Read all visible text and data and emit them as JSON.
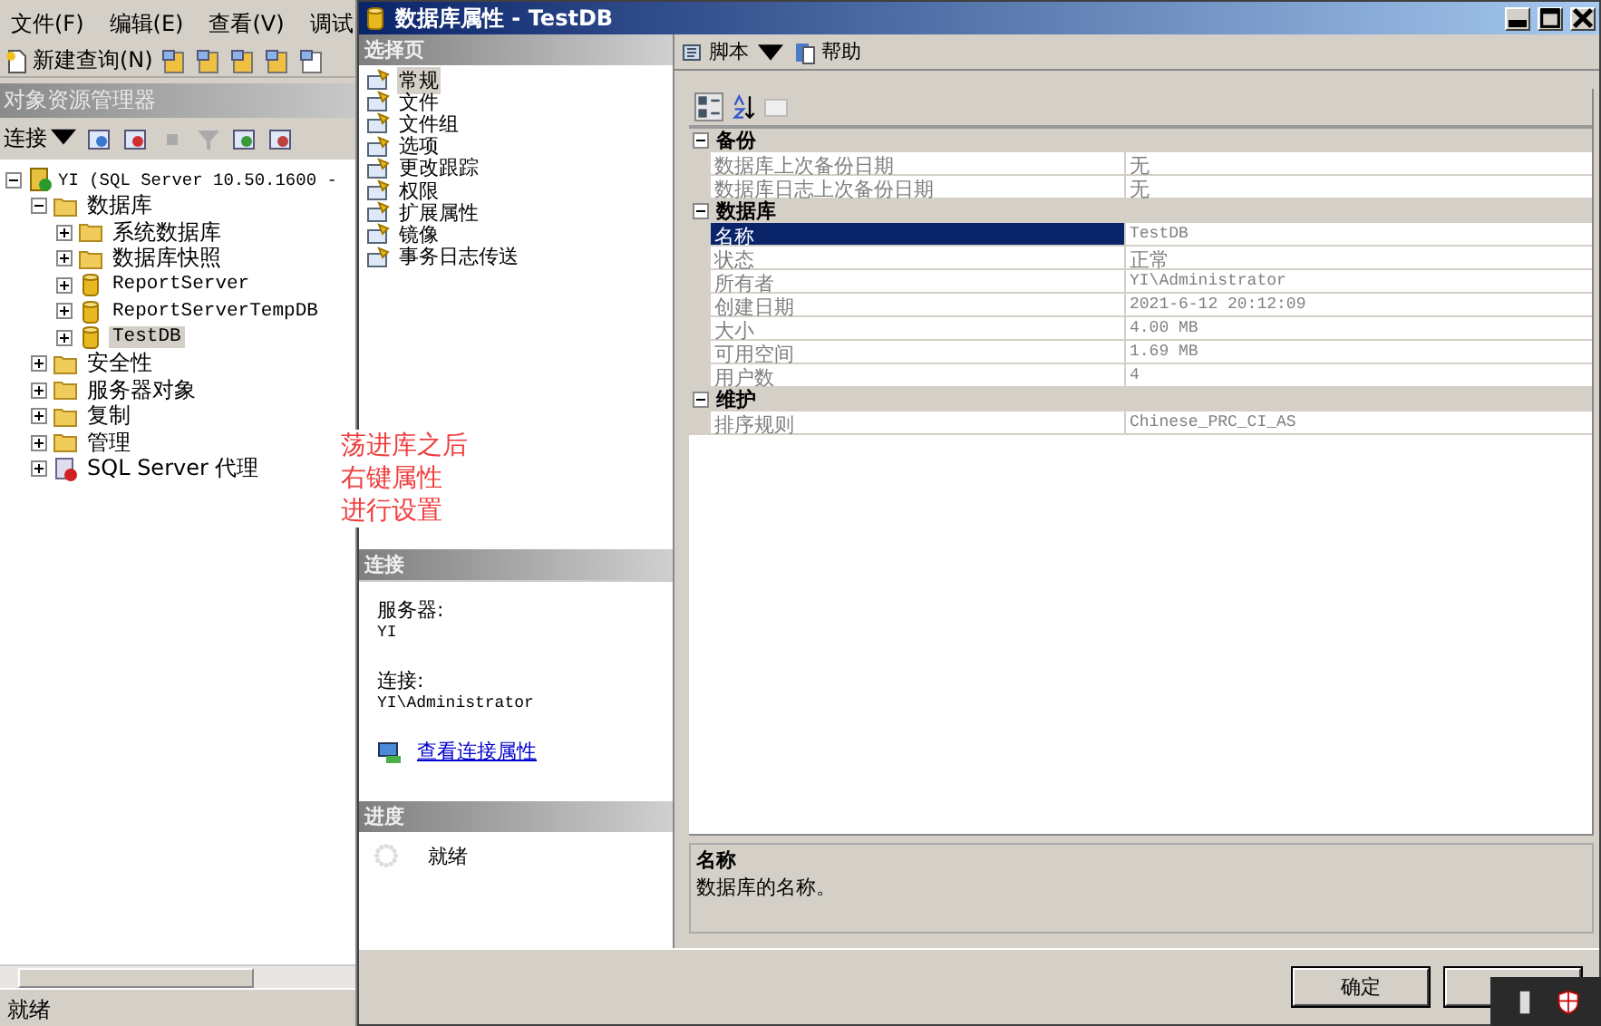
{
  "explorer": {
    "menu": [
      {
        "label": "文件(F)"
      },
      {
        "label": "编辑(E)"
      },
      {
        "label": "查看(V)"
      },
      {
        "label": "调试"
      }
    ],
    "new_query": "新建查询(N)",
    "title": "对象资源管理器",
    "connect": "连接",
    "tree": [
      {
        "label": "YI (SQL Server 10.50.1600 -",
        "kind": "server",
        "expanded": true,
        "selected": false,
        "children": [
          {
            "label": "数据库",
            "kind": "folder",
            "expanded": true,
            "selected": false,
            "children": [
              {
                "label": "系统数据库",
                "kind": "folder",
                "expanded": false,
                "selected": false
              },
              {
                "label": "数据库快照",
                "kind": "folder",
                "expanded": false,
                "selected": false
              },
              {
                "label": "ReportServer",
                "kind": "database",
                "expanded": false,
                "selected": false
              },
              {
                "label": "ReportServerTempDB",
                "kind": "database",
                "expanded": false,
                "selected": false
              },
              {
                "label": "TestDB",
                "kind": "database",
                "expanded": false,
                "selected": true
              }
            ]
          },
          {
            "label": "安全性",
            "kind": "folder",
            "expanded": false,
            "selected": false
          },
          {
            "label": "服务器对象",
            "kind": "folder",
            "expanded": false,
            "selected": false
          },
          {
            "label": "复制",
            "kind": "folder",
            "expanded": false,
            "selected": false
          },
          {
            "label": "管理",
            "kind": "folder",
            "expanded": false,
            "selected": false
          },
          {
            "label": "SQL Server 代理",
            "kind": "agent",
            "expanded": false,
            "selected": false
          }
        ]
      }
    ],
    "status": "就绪"
  },
  "note": [
    "荡进库之后",
    "右键属性",
    "进行设置"
  ],
  "dialog": {
    "title": "数据库属性 - TestDB",
    "select_page": {
      "title": "选择页",
      "items": [
        {
          "label": "常规",
          "selected": true
        },
        {
          "label": "文件",
          "selected": false
        },
        {
          "label": "文件组",
          "selected": false
        },
        {
          "label": "选项",
          "selected": false
        },
        {
          "label": "更改跟踪",
          "selected": false
        },
        {
          "label": "权限",
          "selected": false
        },
        {
          "label": "扩展属性",
          "selected": false
        },
        {
          "label": "镜像",
          "selected": false
        },
        {
          "label": "事务日志传送",
          "selected": false
        }
      ]
    },
    "connection": {
      "title": "连接",
      "server_label": "服务器:",
      "server": "YI",
      "connection_label": "连接:",
      "connection": "YI\\Administrator",
      "link": "查看连接属性"
    },
    "progress": {
      "title": "进度",
      "status": "就绪"
    },
    "toolbar": [
      {
        "label": "脚本",
        "kind": "script"
      },
      {
        "label": "帮助",
        "kind": "help"
      }
    ],
    "grid": [
      {
        "name": "备份",
        "expanded": true,
        "rows": [
          {
            "name": "数据库上次备份日期",
            "value": "无",
            "selected": false
          },
          {
            "name": "数据库日志上次备份日期",
            "value": "无",
            "selected": false
          }
        ]
      },
      {
        "name": "数据库",
        "expanded": true,
        "rows": [
          {
            "name": "名称",
            "value": "TestDB",
            "selected": true
          },
          {
            "name": "状态",
            "value": "正常",
            "selected": false
          },
          {
            "name": "所有者",
            "value": "YI\\Administrator",
            "selected": false
          },
          {
            "name": "创建日期",
            "value": "2021-6-12 20:12:09",
            "selected": false
          },
          {
            "name": "大小",
            "value": "4.00 MB",
            "selected": false
          },
          {
            "name": "可用空间",
            "value": "1.69 MB",
            "selected": false
          },
          {
            "name": "用户数",
            "value": "4",
            "selected": false
          }
        ]
      },
      {
        "name": "维护",
        "expanded": true,
        "rows": [
          {
            "name": "排序规则",
            "value": "Chinese_PRC_CI_AS",
            "selected": false
          }
        ]
      }
    ],
    "description": {
      "title": "名称",
      "text": "数据库的名称。"
    },
    "ok": "确定"
  }
}
